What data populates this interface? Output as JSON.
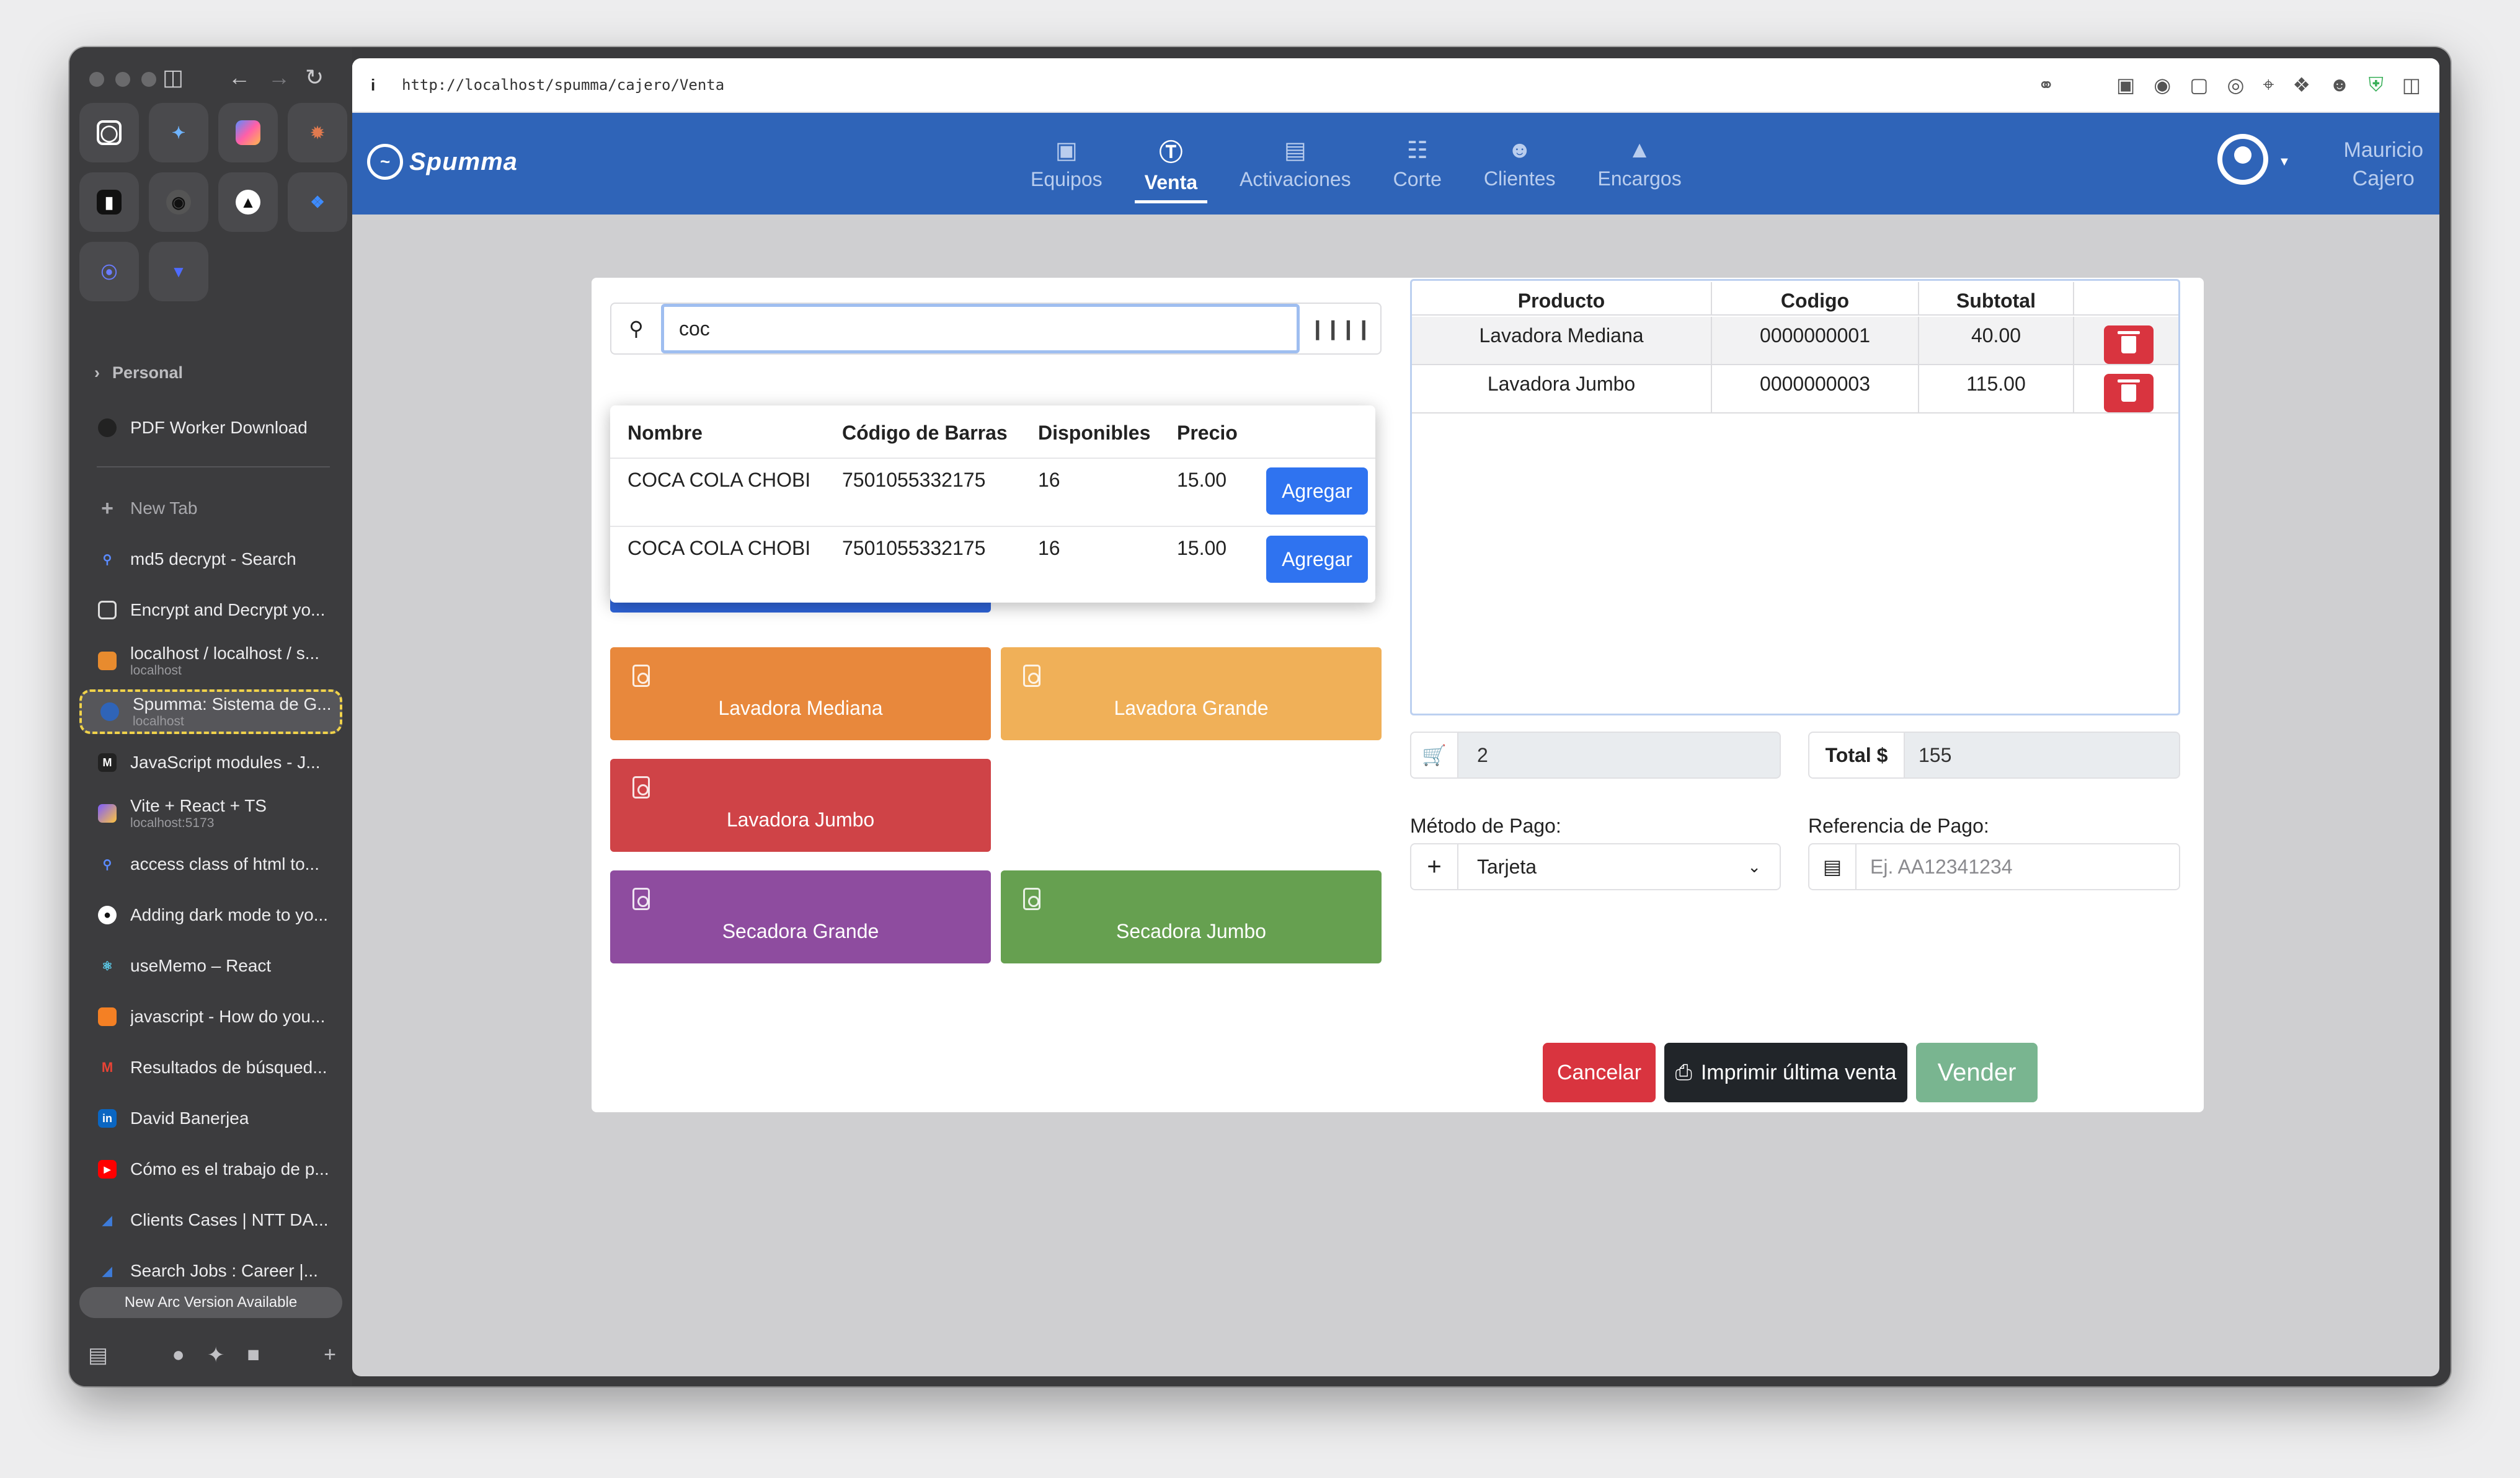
{
  "sidebar": {
    "folder": "Personal",
    "pinned_item": "PDF Worker Download",
    "new_tab": "New Tab",
    "tabs": [
      {
        "label": "md5 decrypt - Search",
        "sub": ""
      },
      {
        "label": "Encrypt and Decrypt yo...",
        "sub": ""
      },
      {
        "label": "localhost / localhost / s...",
        "sub": "localhost"
      },
      {
        "label": "Spumma: Sistema de G...",
        "sub": "localhost"
      },
      {
        "label": "JavaScript modules - J...",
        "sub": ""
      },
      {
        "label": "Vite + React + TS",
        "sub": "localhost:5173"
      },
      {
        "label": "access class of html to...",
        "sub": ""
      },
      {
        "label": "Adding dark mode to yo...",
        "sub": ""
      },
      {
        "label": "useMemo – React",
        "sub": ""
      },
      {
        "label": "javascript - How do you...",
        "sub": ""
      },
      {
        "label": "Resultados de búsqued...",
        "sub": ""
      },
      {
        "label": "David Banerjea",
        "sub": ""
      },
      {
        "label": "Cómo es el trabajo de p...",
        "sub": ""
      },
      {
        "label": "Clients Cases | NTT DA...",
        "sub": ""
      },
      {
        "label": "Search Jobs : Career |...",
        "sub": ""
      }
    ],
    "banner": "New Arc Version Available"
  },
  "browser": {
    "url": "http://localhost/spumma/cajero/Venta"
  },
  "app": {
    "logo": "Spumma",
    "nav": [
      {
        "label": "Equipos",
        "icon": "washer-icon"
      },
      {
        "label": "Venta",
        "icon": "dollar-icon"
      },
      {
        "label": "Activaciones",
        "icon": "card-icon"
      },
      {
        "label": "Corte",
        "icon": "clipboard-icon"
      },
      {
        "label": "Clientes",
        "icon": "users-icon"
      },
      {
        "label": "Encargos",
        "icon": "service-bell-icon"
      }
    ],
    "user": {
      "first": "Mauricio",
      "second": "Cajero"
    }
  },
  "search": {
    "value": "coc",
    "results_headers": [
      "Nombre",
      "Código de Barras",
      "Disponibles",
      "Precio"
    ],
    "results": [
      {
        "nombre": "COCA COLA CHOBI",
        "codigo": "7501055332175",
        "disponibles": "16",
        "precio": "15.00",
        "action": "Agregar"
      },
      {
        "nombre": "COCA COLA CHOBI",
        "codigo": "7501055332175",
        "disponibles": "16",
        "precio": "15.00",
        "action": "Agregar"
      }
    ]
  },
  "tiles": [
    {
      "label": "Lavadora Mediana",
      "color": "#e8883c"
    },
    {
      "label": "Lavadora Grande",
      "color": "#f0b058"
    },
    {
      "label": "Lavadora Jumbo",
      "color": "#cf4347"
    },
    {
      "label": "Secadora Grande",
      "color": "#8e4c9f"
    },
    {
      "label": "Secadora Jumbo",
      "color": "#66a050"
    }
  ],
  "cart": {
    "headers": [
      "Producto",
      "Codigo",
      "Subtotal"
    ],
    "rows": [
      {
        "producto": "Lavadora Mediana",
        "codigo": "0000000001",
        "subtotal": "40.00"
      },
      {
        "producto": "Lavadora Jumbo",
        "codigo": "0000000003",
        "subtotal": "115.00"
      }
    ],
    "count": "2",
    "total_label": "Total $",
    "total": "155"
  },
  "payment": {
    "method_label": "Método de Pago:",
    "method_value": "Tarjeta",
    "reference_label": "Referencia de Pago:",
    "reference_placeholder": "Ej. AA12341234"
  },
  "actions": {
    "cancel": "Cancelar",
    "print": "Imprimir última venta",
    "sell": "Vender"
  },
  "colors": {
    "navbar": "#2f64b8",
    "primary": "#2f73f0",
    "danger": "#d9343f",
    "dark": "#212529",
    "success": "#79b590"
  }
}
